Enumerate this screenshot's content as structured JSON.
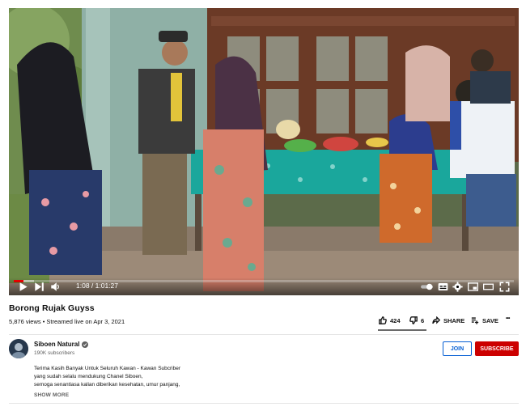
{
  "player": {
    "time_display": "1:08 / 1:01:27",
    "progress_fraction": 0.02,
    "buffered_fraction": 0.04,
    "controls": [
      "play-icon",
      "next-icon",
      "volume-icon",
      "autoplay-toggle-icon",
      "subtitles-icon",
      "settings-icon",
      "miniplayer-icon",
      "theater-icon",
      "fullscreen-icon"
    ]
  },
  "video": {
    "title": "Borong Rujak Guyss",
    "views": "5,876 views",
    "separator": " • ",
    "streamed": "Streamed live on Apr 3, 2021"
  },
  "actions": {
    "like_count": "424",
    "dislike_count": "6",
    "share_label": "SHARE",
    "save_label": "SAVE",
    "more_label": "•••"
  },
  "channel": {
    "name": "Siboen Natural",
    "subscribers": "190K subscribers",
    "join_label": "JOIN",
    "subscribe_label": "SUBSCRIBE"
  },
  "description": {
    "line1": "Terima Kasih Banyak Untuk Seluruh Kawan - Kawan Subcriber",
    "line2": "yang sudah selalu mendukung Chanel Siboen,",
    "line3": "semoga senantiasa kalian diberikan kesehatan, umur panjang,",
    "show_more_label": "SHOW MORE"
  },
  "colors": {
    "subscribe_red": "#cc0000",
    "join_blue": "#065fd4",
    "progress_red": "#ff0000"
  }
}
